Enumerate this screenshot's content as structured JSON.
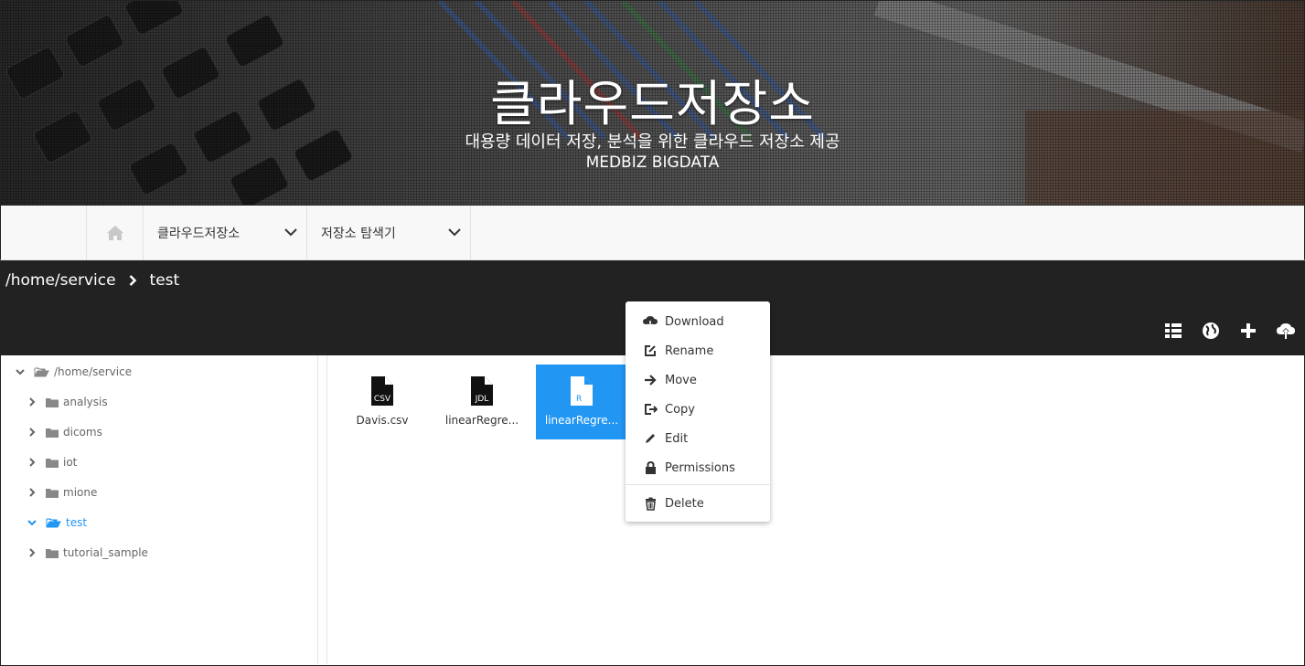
{
  "hero": {
    "title": "클라우드저장소",
    "subtitle": "대용량 데이터 저장, 분석을 위한 클라우드 저장소 제공",
    "brand": "MEDBIZ BIGDATA"
  },
  "navbar": {
    "home_icon": "home-icon",
    "menu1": "클라우드저장소",
    "menu2": "저장소 탐색기"
  },
  "breadcrumb": {
    "root": "/home/service",
    "current": "test"
  },
  "toolbar_icons": [
    "list-view-icon",
    "globe-icon",
    "plus-icon",
    "cloud-upload-icon"
  ],
  "tree": {
    "root": "/home/service",
    "items": [
      {
        "label": "analysis"
      },
      {
        "label": "dicoms"
      },
      {
        "label": "iot"
      },
      {
        "label": "mione"
      },
      {
        "label": "test"
      },
      {
        "label": "tutorial_sample"
      }
    ],
    "active_color": "#2196f3"
  },
  "files": [
    {
      "name": "Davis.csv",
      "badge": "CSV"
    },
    {
      "name": "linearRegre...",
      "badge": "JDL"
    },
    {
      "name": "linearRegre...",
      "badge": "R"
    }
  ],
  "context_menu": {
    "items": [
      "Download",
      "Rename",
      "Move",
      "Copy",
      "Edit",
      "Permissions"
    ],
    "delete": "Delete"
  },
  "colors": {
    "accent": "#2196f3",
    "toolbar": "#222222",
    "navbar": "#f8f8f8"
  }
}
